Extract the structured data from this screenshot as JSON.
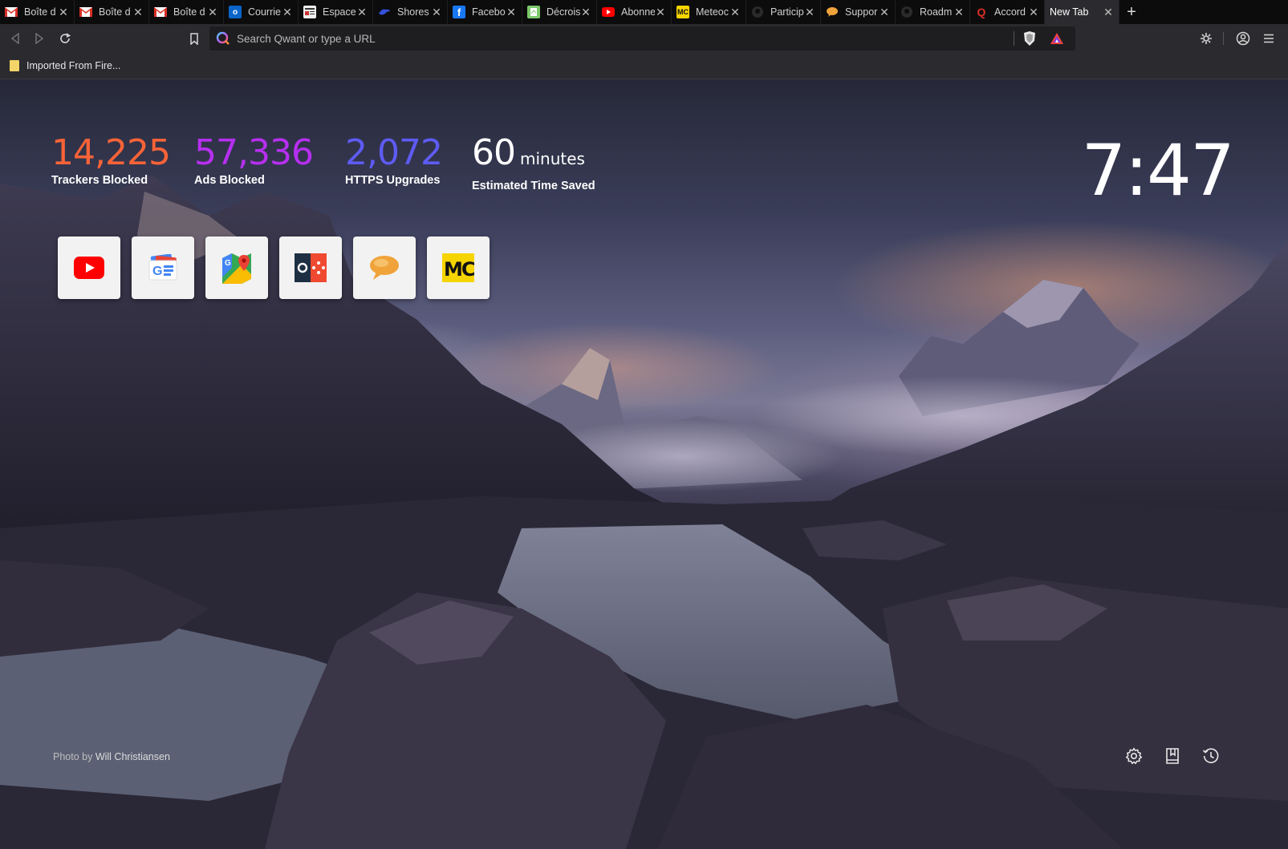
{
  "tabs": [
    {
      "title": "Boîte d",
      "favicon": "gmail-icon",
      "color": "#c5221f"
    },
    {
      "title": "Boîte d",
      "favicon": "gmail-icon",
      "color": "#c5221f"
    },
    {
      "title": "Boîte d",
      "favicon": "gmail-icon",
      "color": "#c5221f"
    },
    {
      "title": "Courrie",
      "favicon": "outlook-icon",
      "color": "#0a64c9"
    },
    {
      "title": "Espace",
      "favicon": "newspaper-icon",
      "color": "#e0e0e0"
    },
    {
      "title": "Shores",
      "favicon": "bird-icon",
      "color": "#3550d8"
    },
    {
      "title": "Facebo",
      "favicon": "facebook-icon",
      "color": "#1877f2"
    },
    {
      "title": "Décrois",
      "favicon": "document-icon",
      "color": "#7cc96b"
    },
    {
      "title": "Abonne",
      "favicon": "youtube-icon",
      "color": "#ff0000"
    },
    {
      "title": "Meteoc",
      "favicon": "mc-icon",
      "color": "#f5d400"
    },
    {
      "title": "Particip",
      "favicon": "github-icon",
      "color": "#2a2a2a"
    },
    {
      "title": "Suppor",
      "favicon": "chat-bubble-icon",
      "color": "#f0a33a"
    },
    {
      "title": "Roadm",
      "favicon": "github-icon",
      "color": "#2a2a2a"
    },
    {
      "title": "Accord",
      "favicon": "qwant-icon",
      "color": "#d93025"
    }
  ],
  "active_tab": {
    "title": "New Tab"
  },
  "toolbar": {
    "search_placeholder": "Search Qwant or type a URL"
  },
  "bookmarks": [
    {
      "label": "Imported From Fire..."
    }
  ],
  "stats": [
    {
      "value": "14,225",
      "unit": "",
      "label": "Trackers Blocked",
      "color": "#f86338"
    },
    {
      "value": "57,336",
      "unit": "",
      "label": "Ads Blocked",
      "color": "#b62ff0"
    },
    {
      "value": "2,072",
      "unit": "",
      "label": "HTTPS Upgrades",
      "color": "#5e5bf4"
    },
    {
      "value": "60",
      "unit": "minutes",
      "label": "Estimated Time Saved",
      "color": "#ffffff"
    }
  ],
  "clock": "7:47",
  "top_sites": [
    {
      "name": "youtube-site-icon"
    },
    {
      "name": "google-news-site-icon"
    },
    {
      "name": "google-maps-site-icon"
    },
    {
      "name": "game-site-icon"
    },
    {
      "name": "chat-bubble-site-icon"
    },
    {
      "name": "mc-site-icon"
    }
  ],
  "photo_credit": {
    "prefix": "Photo by",
    "author": "Will Christiansen"
  },
  "footer_icons": [
    "settings-icon",
    "bookmarks-icon",
    "history-icon"
  ]
}
